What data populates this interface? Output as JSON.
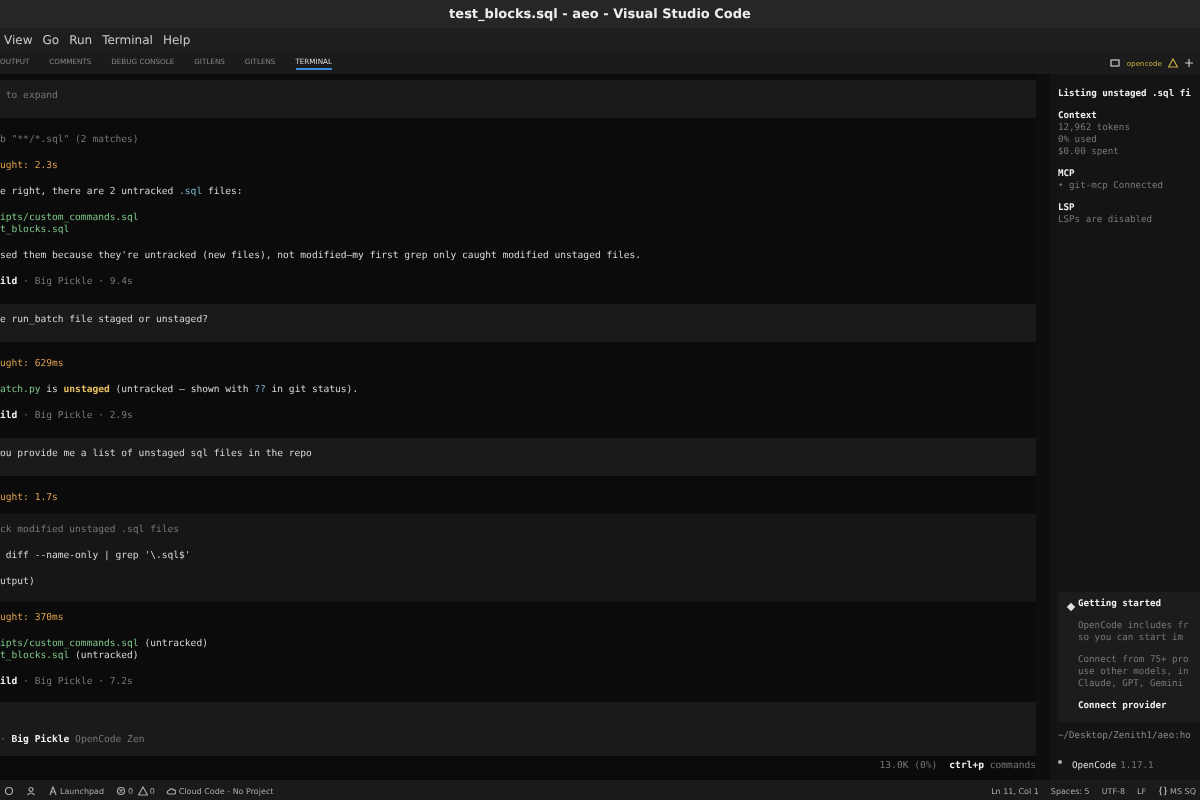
{
  "window": {
    "title": "test_blocks.sql - aeo - Visual Studio Code"
  },
  "menu": [
    "View",
    "Go",
    "Run",
    "Terminal",
    "Help"
  ],
  "panel_tabs": [
    {
      "label": "OUTPUT",
      "selected": false
    },
    {
      "label": "COMMENTS",
      "selected": false
    },
    {
      "label": "DEBUG CONSOLE",
      "selected": false
    },
    {
      "label": "GITLENS",
      "selected": false
    },
    {
      "label": "GITLENS",
      "selected": false
    },
    {
      "label": "TERMINAL",
      "selected": true
    }
  ],
  "terminal_name": "opencode",
  "transcript": [
    {
      "kind": "user",
      "paragraphs": [
        [
          [
            {
              "text": " to expand",
              "kind": "dim"
            }
          ]
        ]
      ]
    },
    {
      "kind": "reply",
      "paragraphs": [
        [
          [
            {
              "text": "b \"**/*.sql\" (2 matches)",
              "kind": "dim"
            }
          ]
        ],
        [
          [
            {
              "text": "ught: 2.3s",
              "kind": "orange"
            }
          ]
        ],
        [
          [
            {
              "text": "e right, there are 2 untracked ",
              "kind": "plain"
            },
            {
              "text": ".sql",
              "kind": "code"
            },
            {
              "text": " files:",
              "kind": "plain"
            }
          ]
        ],
        [
          [
            {
              "text": "ipts/custom_commands.sql",
              "kind": "green"
            }
          ],
          [
            {
              "text": "t_blocks.sql",
              "kind": "green"
            }
          ]
        ],
        [
          [
            {
              "text": "sed them because they're untracked (new files), not modified—my first grep only caught modified unstaged files.",
              "kind": "plain"
            }
          ]
        ],
        [
          [
            {
              "text": "ild",
              "kind": "bold"
            },
            {
              "text": " · Big Pickle · 9.4s",
              "kind": "dim"
            }
          ]
        ]
      ]
    },
    {
      "kind": "user",
      "paragraphs": [
        [
          [
            {
              "text": "e run_batch file staged or unstaged?",
              "kind": "plain"
            }
          ]
        ]
      ]
    },
    {
      "kind": "reply",
      "paragraphs": [
        [
          [
            {
              "text": "ught: 629ms",
              "kind": "orange"
            }
          ]
        ],
        [
          [
            {
              "text": "atch.py",
              "kind": "green"
            },
            {
              "text": " is ",
              "kind": "plain"
            },
            {
              "text": "unstaged",
              "kind": "highlight"
            },
            {
              "text": " (untracked — shown with ",
              "kind": "plain"
            },
            {
              "text": "??",
              "kind": "code"
            },
            {
              "text": " in git status).",
              "kind": "plain"
            }
          ]
        ],
        [
          [
            {
              "text": "ild",
              "kind": "bold"
            },
            {
              "text": " · Big Pickle · 2.9s",
              "kind": "dim"
            }
          ]
        ]
      ]
    },
    {
      "kind": "user",
      "paragraphs": [
        [
          [
            {
              "text": "ou provide me a list of unstaged sql files in the repo",
              "kind": "plain"
            }
          ]
        ]
      ]
    },
    {
      "kind": "reply",
      "paragraphs": [
        [
          [
            {
              "text": "ught: 1.7s",
              "kind": "orange"
            }
          ]
        ]
      ]
    },
    {
      "kind": "tool",
      "paragraphs": [
        [
          [
            {
              "text": "ck modified unstaged .sql files",
              "kind": "dim"
            }
          ]
        ],
        [
          [
            {
              "text": " diff --name-only | grep '\\.sql$'",
              "kind": "plain"
            }
          ]
        ],
        [
          [
            {
              "text": "utput)",
              "kind": "plain"
            }
          ]
        ]
      ]
    },
    {
      "kind": "reply",
      "paragraphs": [
        [
          [
            {
              "text": "ught: 370ms",
              "kind": "orange"
            }
          ]
        ],
        [
          [
            {
              "text": "ipts/custom_commands.sql",
              "kind": "green"
            },
            {
              "text": " (untracked)",
              "kind": "plain"
            }
          ],
          [
            {
              "text": "t_blocks.sql",
              "kind": "green"
            },
            {
              "text": " (untracked)",
              "kind": "plain"
            }
          ]
        ],
        [
          [
            {
              "text": "ild",
              "kind": "bold"
            },
            {
              "text": " · Big Pickle · 7.2s",
              "kind": "dim"
            }
          ]
        ]
      ]
    }
  ],
  "prompt": [
    {
      "text": "· ",
      "kind": "dim"
    },
    {
      "text": "Big Pickle",
      "kind": "bold"
    },
    {
      "text": " OpenCode Zen",
      "kind": "dim"
    }
  ],
  "footer": {
    "tokens": "13.0K (0%)",
    "shortcut": "ctrl+p",
    "shortcut_label": "commands"
  },
  "sidebar": {
    "title": "Listing unstaged .sql fi",
    "sections": [
      {
        "heading": "Context",
        "lines": [
          "12,962 tokens",
          "0% used",
          "$0.00 spent"
        ]
      },
      {
        "heading": "MCP",
        "lines": [
          "• git-mcp Connected"
        ]
      },
      {
        "heading": "LSP",
        "lines": [
          "LSPs are disabled"
        ]
      }
    ],
    "card": {
      "title": "Getting started",
      "paragraphs": [
        [
          "OpenCode includes fr",
          "so you can start im"
        ],
        [
          "Connect from 75+ pro",
          "use other models, in",
          "Claude, GPT, Gemini"
        ]
      ],
      "action": "Connect provider"
    },
    "path": "~/Desktop/Zenith1/aeo:ho",
    "version": {
      "name": "OpenCode",
      "number": "1.17.1"
    }
  },
  "status_bar": {
    "launchpad": "Launchpad",
    "errors": "0",
    "warnings": "0",
    "cloud": "Cloud Code - No Project",
    "right": [
      "Ln 11, Col 1",
      "Spaces: 5",
      "UTF-8",
      "LF",
      "MS SQ"
    ]
  }
}
